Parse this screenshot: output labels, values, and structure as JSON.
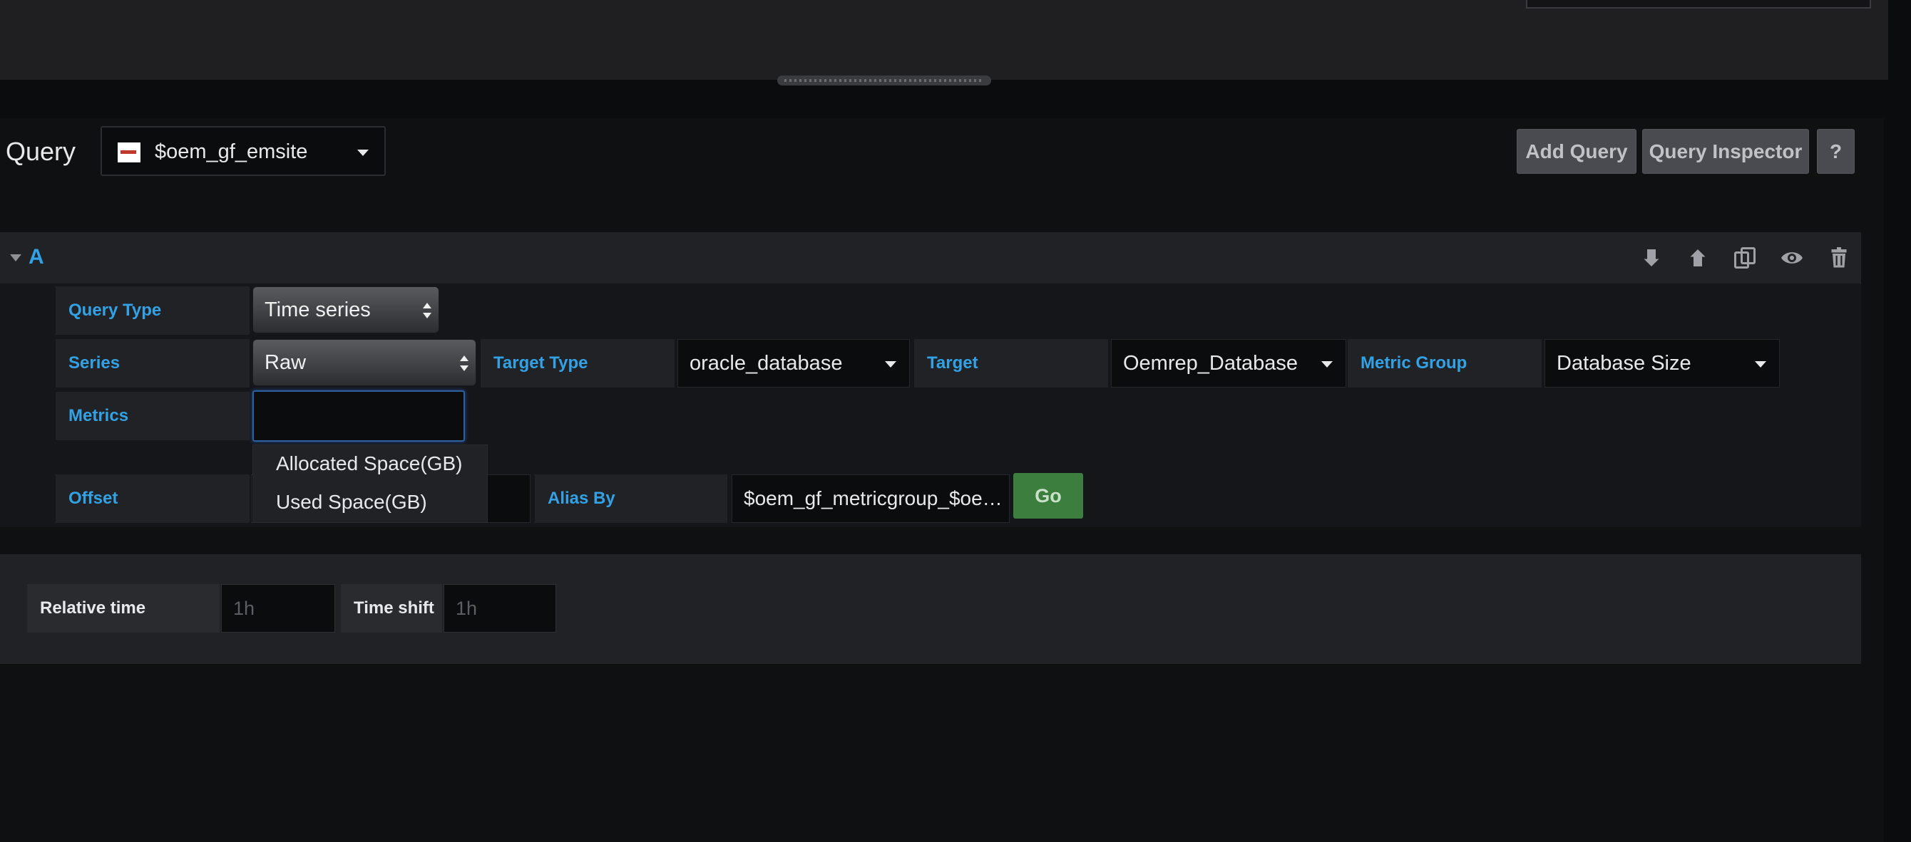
{
  "header": {
    "title": "Query",
    "datasource": "$oem_gf_emsite",
    "buttons": {
      "add_query": "Add Query",
      "query_inspector": "Query Inspector",
      "help": "?"
    }
  },
  "query_row": {
    "letter": "A",
    "icons": [
      "arrow-down-icon",
      "arrow-up-icon",
      "duplicate-icon",
      "eye-icon",
      "trash-icon"
    ],
    "query_type": {
      "label": "Query Type",
      "value": "Time series"
    },
    "series": {
      "label": "Series",
      "value": "Raw"
    },
    "target_type": {
      "label": "Target Type",
      "value": "oracle_database"
    },
    "target": {
      "label": "Target",
      "value": "Oemrep_Database"
    },
    "metric_group": {
      "label": "Metric Group",
      "value": "Database Size"
    },
    "metrics": {
      "label": "Metrics",
      "value": ""
    },
    "metrics_options": [
      "Allocated Space(GB)",
      "Used Space(GB)"
    ],
    "offset": {
      "label": "Offset"
    },
    "alias_by": {
      "label": "Alias By",
      "value": "$oem_gf_metricgroup_$oe…"
    },
    "go_label": "Go"
  },
  "time_options": {
    "relative_time": {
      "label": "Relative time",
      "placeholder": "1h"
    },
    "time_shift": {
      "label": "Time shift",
      "placeholder": "1h"
    }
  }
}
